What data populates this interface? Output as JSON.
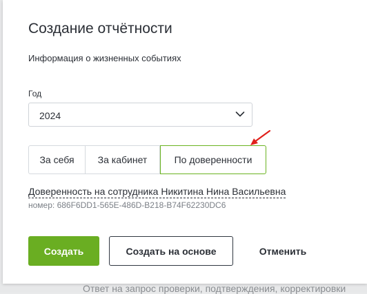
{
  "dialog": {
    "title": "Создание отчётности",
    "subtitle": "Информация о жизненных событиях"
  },
  "year": {
    "label": "Год",
    "value": "2024"
  },
  "segments": [
    {
      "label": "За себя",
      "active": false
    },
    {
      "label": "За кабинет",
      "active": false
    },
    {
      "label": "По доверенности",
      "active": true
    }
  ],
  "proxy": {
    "link_text": "Доверенность на сотрудника Никитина Нина Васильевна",
    "number_text": "номер: 686F6DD1-565E-486D-B218-B74F62230DC6"
  },
  "actions": {
    "create_label": "Создать",
    "create_based_label": "Создать на основе",
    "cancel_label": "Отменить"
  },
  "background": {
    "partial_text": "Ответ на запрос проверки, подтверждения, корректировки"
  },
  "colors": {
    "accent": "#6aae22",
    "annotation_arrow": "#e0201b"
  }
}
